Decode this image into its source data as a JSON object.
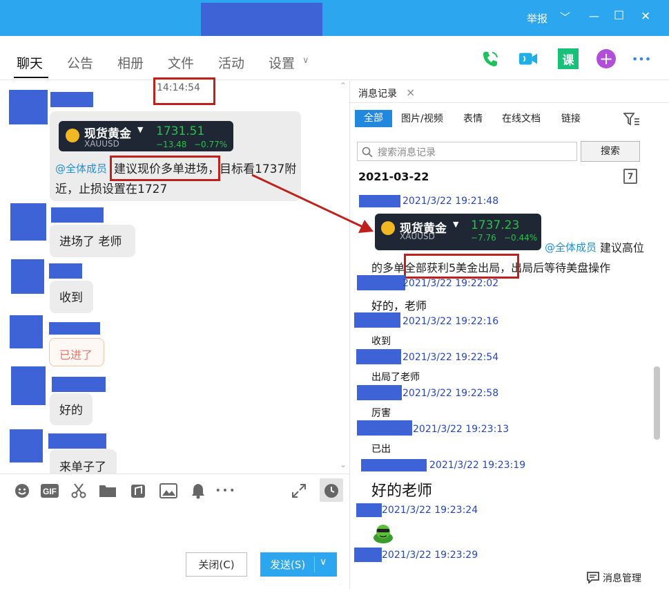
{
  "titlebar": {
    "report": "举报",
    "chevron": "﹀",
    "minimize": "—",
    "maximize": "☐",
    "close": "✕"
  },
  "tabs": [
    {
      "label": "聊天"
    },
    {
      "label": "公告"
    },
    {
      "label": "相册"
    },
    {
      "label": "文件"
    },
    {
      "label": "活动"
    },
    {
      "label": "设置"
    }
  ],
  "tab_settings_chevron": "∨",
  "top_icons": {
    "course": "课",
    "plus": "+",
    "more": "•••"
  },
  "chat": {
    "time": "14:14:54",
    "gold_card": {
      "name": "现货黄金",
      "sub": "XAUUSD",
      "price": "1731.51",
      "change": "−13.48",
      "pct": "−0.77%"
    },
    "msg1_at": "@全体成员",
    "msg1_line1": "建议现价多单进场，目标看1737附",
    "msg1_line2": "近，止损设置在1727",
    "msg2": "进场了 老师",
    "msg3": "收到",
    "msg4": "已进了",
    "msg5": "好的",
    "msg6": "来单子了"
  },
  "input": {
    "close_label": "关闭(C)",
    "send_label": "发送(S)",
    "send_arrow": "∨"
  },
  "panel": {
    "tab_label": "消息记录",
    "tab_close": "×",
    "filters": [
      "全部",
      "图片/视频",
      "表情",
      "在线文档",
      "链接"
    ],
    "search_placeholder": "搜索消息记录",
    "search_button": "搜索",
    "date": "2021-03-22",
    "calendar_day": "7",
    "gold_card": {
      "name": "现货黄金",
      "sub": "XAUUSD",
      "price": "1737.23",
      "change": "−7.76",
      "pct": "−0.44%"
    },
    "ts1": "2021/3/22 19:21:48",
    "m1_at": "@全体成员",
    "m1_tail": " 建议高位",
    "m1_line2": "的多单全部获利5美金出局，出局后等待美盘操作",
    "ts2": "2021/3/22 19:22:02",
    "m2": "好的，老师",
    "ts3": "2021/3/22 19:22:16",
    "m3": "收到",
    "ts4": "2021/3/22 19:22:54",
    "m4": "出局了老师",
    "ts5": "2021/3/22 19:22:58",
    "m5": "厉害",
    "ts6": "2021/3/22 19:23:13",
    "m6": "已出",
    "ts7": "2021/3/22 19:23:19",
    "m7": "好的老师",
    "ts8": "2021/3/22 19:23:24",
    "ts9": "2021/3/22 19:23:29",
    "manage": "消息管理"
  }
}
